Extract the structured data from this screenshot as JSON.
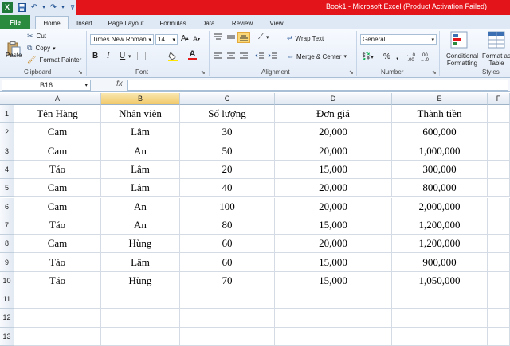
{
  "app": {
    "title": "Book1  -  Microsoft Excel (Product Activation Failed)"
  },
  "tabs": [
    {
      "label": "File"
    },
    {
      "label": "Home"
    },
    {
      "label": "Insert"
    },
    {
      "label": "Page Layout"
    },
    {
      "label": "Formulas"
    },
    {
      "label": "Data"
    },
    {
      "label": "Review"
    },
    {
      "label": "View"
    }
  ],
  "ribbon": {
    "clipboard": {
      "paste": "Paste",
      "cut": "Cut",
      "copy": "Copy",
      "format_painter": "Format Painter",
      "label": "Clipboard"
    },
    "font": {
      "name": "Times New Roman",
      "size": "14",
      "label": "Font"
    },
    "alignment": {
      "wrap_text": "Wrap Text",
      "merge_center": "Merge & Center",
      "label": "Alignment"
    },
    "number": {
      "format": "General",
      "label": "Number"
    },
    "styles": {
      "conditional_formatting": "Conditional Formatting",
      "format_as_table": "Format as Table",
      "label": "Styles"
    }
  },
  "formula_bar": {
    "name_box": "B16",
    "fx": "fx",
    "value": ""
  },
  "sheet": {
    "columns": [
      "A",
      "B",
      "C",
      "D",
      "E",
      "F"
    ],
    "selected_column": "B",
    "row_numbers": [
      "1",
      "2",
      "3",
      "4",
      "5",
      "6",
      "7",
      "8",
      "9",
      "10",
      "11",
      "12",
      "13"
    ],
    "rows": [
      [
        "Tên Hàng",
        "Nhân viên",
        "Số lượng",
        "Đơn giá",
        "Thành tiền"
      ],
      [
        "Cam",
        "Lâm",
        "30",
        "20,000",
        "600,000"
      ],
      [
        "Cam",
        "An",
        "50",
        "20,000",
        "1,000,000"
      ],
      [
        "Táo",
        "Lâm",
        "20",
        "15,000",
        "300,000"
      ],
      [
        "Cam",
        "Lâm",
        "40",
        "20,000",
        "800,000"
      ],
      [
        "Cam",
        "An",
        "100",
        "20,000",
        "2,000,000"
      ],
      [
        "Táo",
        "An",
        "80",
        "15,000",
        "1,200,000"
      ],
      [
        "Cam",
        "Hùng",
        "60",
        "20,000",
        "1,200,000"
      ],
      [
        "Táo",
        "Lâm",
        "60",
        "15,000",
        "900,000"
      ],
      [
        "Táo",
        "Hùng",
        "70",
        "15,000",
        "1,050,000"
      ]
    ]
  }
}
